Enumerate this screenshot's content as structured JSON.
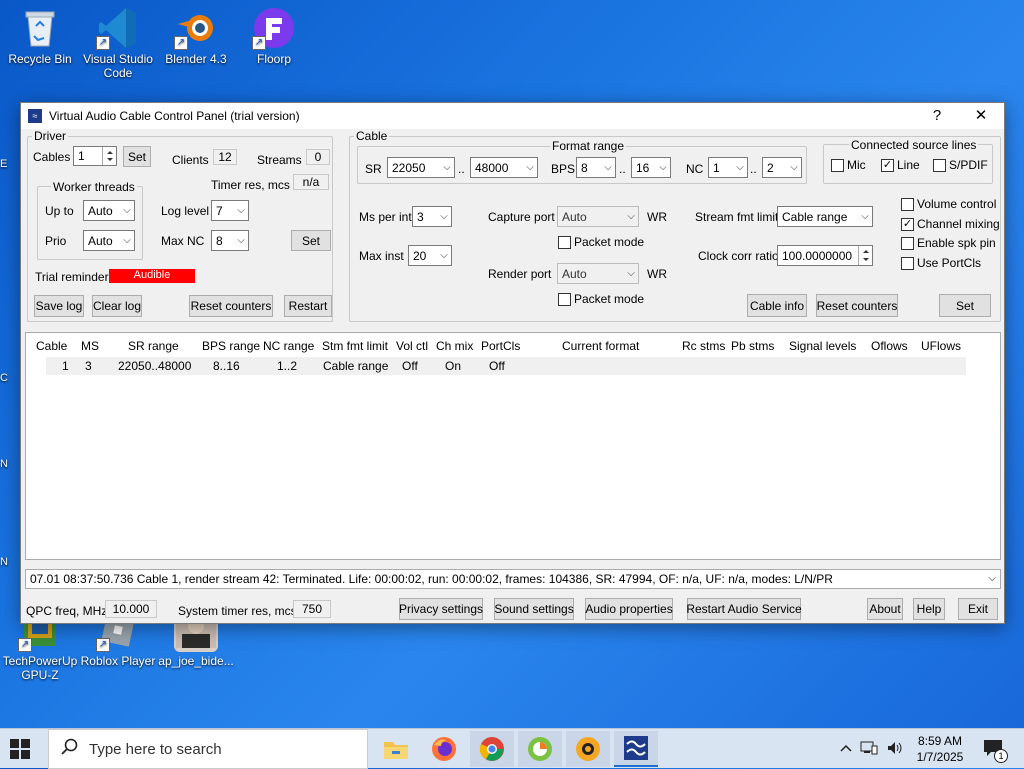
{
  "desktop": {
    "icons": [
      {
        "label": "Recycle Bin"
      },
      {
        "label": "Visual Studio Code"
      },
      {
        "label": "Blender 4.3"
      },
      {
        "label": "Floorp"
      },
      {
        "label": "TechPowerUp GPU-Z"
      },
      {
        "label": "Roblox Player"
      },
      {
        "label": "ap_joe_bide..."
      }
    ],
    "edge_fragments": [
      "E",
      "C",
      "N",
      "N"
    ]
  },
  "window": {
    "title": "Virtual Audio Cable Control Panel (trial version)",
    "help_label": "?",
    "close_label": "✕",
    "driver": {
      "group_label": "Driver",
      "cables_label": "Cables",
      "cables_value": "1",
      "set_label": "Set",
      "clients_label": "Clients",
      "clients_value": "12",
      "streams_label": "Streams",
      "streams_value": "0",
      "timer_res_label": "Timer res, mcs",
      "timer_res_value": "n/a",
      "worker_threads_label": "Worker threads",
      "up_to_label": "Up to",
      "up_to_value": "Auto",
      "prio_label": "Prio",
      "prio_value": "Auto",
      "log_level_label": "Log level",
      "log_level_value": "7",
      "max_nc_label": "Max NC",
      "max_nc_value": "8",
      "set2_label": "Set",
      "trial_reminder_label": "Trial reminder",
      "trial_reminder_value": "Audible",
      "save_log_label": "Save log",
      "clear_log_label": "Clear log",
      "reset_counters_label": "Reset counters",
      "restart_label": "Restart"
    },
    "cable": {
      "group_label": "Cable",
      "format_range_label": "Format range",
      "sr_label": "SR",
      "sr_min": "22050",
      "sr_max": "48000",
      "range_sep": "..",
      "bps_label": "BPS",
      "bps_min": "8",
      "bps_max": "16",
      "nc_label": "NC",
      "nc_min": "1",
      "nc_max": "2",
      "ms_per_int_label": "Ms per int",
      "ms_per_int_value": "3",
      "max_inst_label": "Max inst",
      "max_inst_value": "20",
      "capture_port_label": "Capture port",
      "capture_port_value": "Auto",
      "render_port_label": "Render port",
      "render_port_value": "Auto",
      "wr_label": "WR",
      "packet_mode_label": "Packet mode",
      "stream_fmt_limit_label": "Stream fmt limit",
      "stream_fmt_limit_value": "Cable range",
      "clock_corr_label": "Clock corr ratio",
      "clock_corr_value": "100.0000000",
      "cable_info_label": "Cable info",
      "reset_counters_label": "Reset counters",
      "set_label": "Set",
      "connected_label": "Connected source lines",
      "mic_label": "Mic",
      "line_label": "Line",
      "spdif_label": "S/PDIF",
      "volume_control_label": "Volume control",
      "channel_mixing_label": "Channel mixing",
      "enable_spk_pin_label": "Enable spk pin",
      "use_portcls_label": "Use PortCls",
      "line_checked": true,
      "channel_mixing_checked": true
    },
    "table": {
      "headers": [
        "Cable",
        "MS",
        "SR range",
        "BPS range",
        "NC range",
        "Stm fmt limit",
        "Vol ctl",
        "Ch mix",
        "PortCls",
        "Current format",
        "Rc stms",
        "Pb stms",
        "Signal levels",
        "Oflows",
        "UFlows"
      ],
      "row": [
        "1",
        "3",
        "22050..48000",
        "8..16",
        "1..2",
        "Cable range",
        "Off",
        "On",
        "Off"
      ]
    },
    "log_line": "07.01  08:37:50.736  Cable 1, render stream 42: Terminated. Life: 00:00:02, run: 00:00:02, frames: 104386, SR: 47994, OF: n/a, UF: n/a, modes: L/N/PR",
    "footer": {
      "qpc_label": "QPC freq, MHz",
      "qpc_value": "10.000",
      "systimer_label": "System timer res, mcs",
      "systimer_value": "750",
      "privacy_label": "Privacy settings",
      "sound_label": "Sound settings",
      "audio_props_label": "Audio properties",
      "restart_audio_label": "Restart Audio Service",
      "about_label": "About",
      "help_label": "Help",
      "exit_label": "Exit"
    }
  },
  "taskbar": {
    "search_placeholder": "Type here to search",
    "time": "8:59 AM",
    "date": "1/7/2025",
    "notification_count": "1"
  }
}
